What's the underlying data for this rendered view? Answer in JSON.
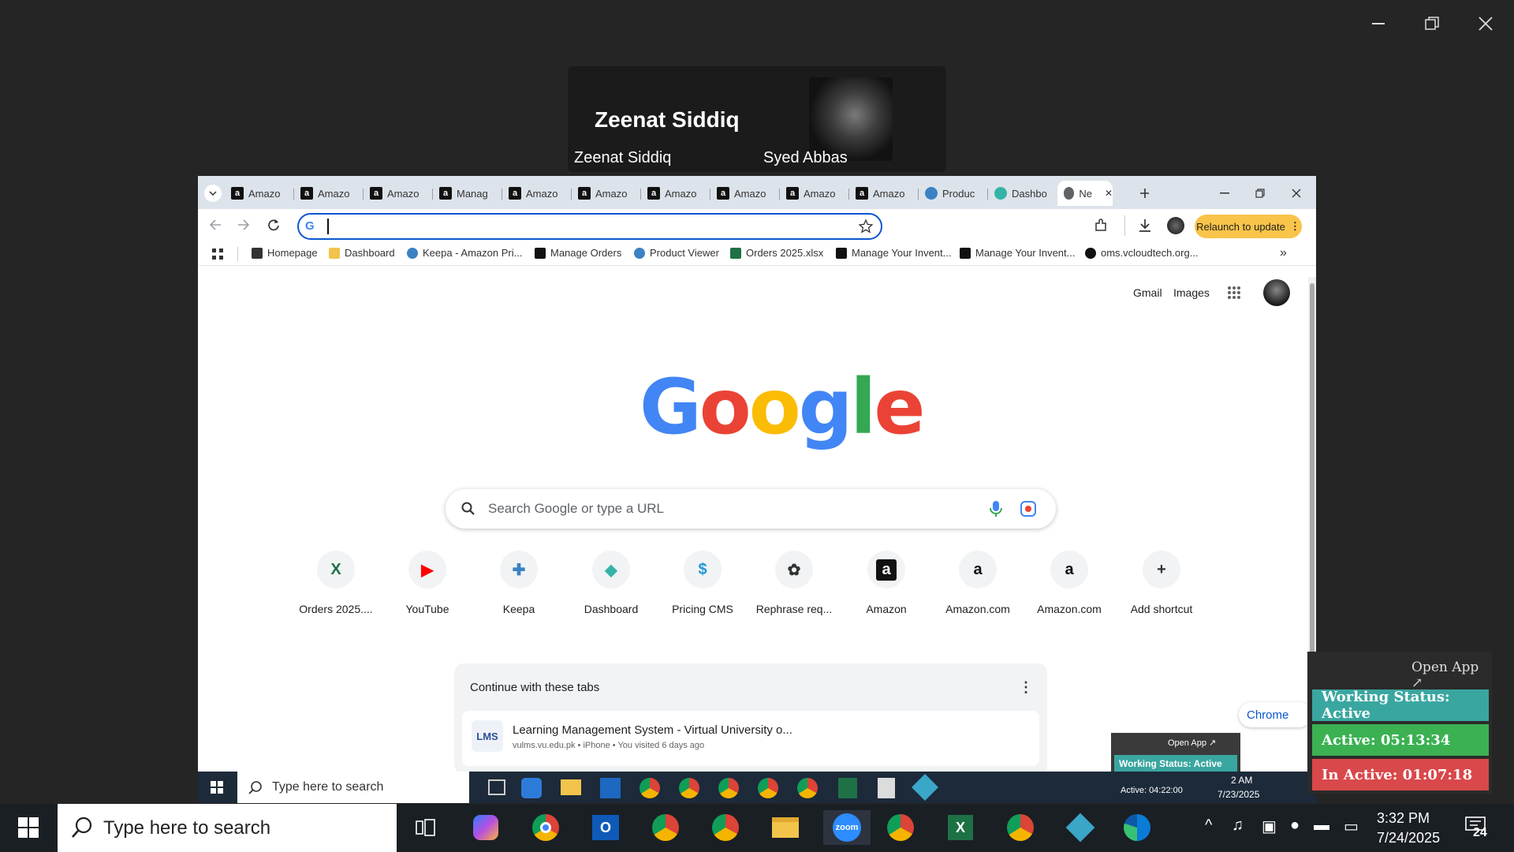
{
  "window": {
    "controls": [
      "minimize",
      "restore",
      "close"
    ]
  },
  "participants": {
    "speaker_name": "Zeenat Siddiq",
    "tiles": [
      {
        "label": "Zeenat Siddiq"
      },
      {
        "label": "Syed Abbas"
      }
    ]
  },
  "browser": {
    "tabs": [
      {
        "label": "Amazo",
        "icon": "amazon-icon"
      },
      {
        "label": "Amazo",
        "icon": "amazon-icon"
      },
      {
        "label": "Amazo",
        "icon": "amazon-icon"
      },
      {
        "label": "Manag",
        "icon": "amazon-icon"
      },
      {
        "label": "Amazo",
        "icon": "amazon-icon"
      },
      {
        "label": "Amazo",
        "icon": "amazon-icon"
      },
      {
        "label": "Amazo",
        "icon": "amazon-icon"
      },
      {
        "label": "Amazo",
        "icon": "amazon-icon"
      },
      {
        "label": "Amazo",
        "icon": "amazon-icon"
      },
      {
        "label": "Amazo",
        "icon": "amazon-icon"
      },
      {
        "label": "Produc",
        "icon": "keepa-icon"
      },
      {
        "label": "Dashbo",
        "icon": "dashboard-icon"
      },
      {
        "label": "Ne",
        "icon": "chrome-icon",
        "active": true
      }
    ],
    "relaunch_label": "Relaunch to update",
    "bookmarks": [
      {
        "label": "Homepage"
      },
      {
        "label": "Dashboard"
      },
      {
        "label": "Keepa - Amazon Pri..."
      },
      {
        "label": "Manage Orders"
      },
      {
        "label": "Product Viewer"
      },
      {
        "label": "Orders 2025.xlsx"
      },
      {
        "label": "Manage Your Invent..."
      },
      {
        "label": "Manage Your Invent..."
      },
      {
        "label": "oms.vcloudtech.org..."
      }
    ],
    "google": {
      "header_links": [
        "Gmail",
        "Images"
      ],
      "search_placeholder": "Search Google or type a URL",
      "shortcuts": [
        {
          "label": "Orders 2025...."
        },
        {
          "label": "YouTube"
        },
        {
          "label": "Keepa"
        },
        {
          "label": "Dashboard"
        },
        {
          "label": "Pricing CMS"
        },
        {
          "label": "Rephrase req..."
        },
        {
          "label": "Amazon"
        },
        {
          "label": "Amazon.com"
        },
        {
          "label": "Amazon.com"
        },
        {
          "label": "Add shortcut"
        }
      ],
      "continue_title": "Continue with these tabs",
      "continue_item_title": "Learning Management System - Virtual University o...",
      "continue_item_meta": "vulms.vu.edu.pk • iPhone • You visited 6 days ago",
      "continue_item_icon_text": "LMS",
      "chrome_link": "Chrome"
    },
    "inner_taskbar": {
      "search_placeholder": "Type here to search",
      "time": "2 AM",
      "date": "7/23/2025",
      "mini_status": {
        "open_app": "Open App ↗",
        "status": "Working Status: Active",
        "active": "Active: 04:22:00"
      }
    }
  },
  "status_widget": {
    "open_app": "Open App ↗",
    "working_status": "Working Status: Active",
    "active": "Active: 05:13:34",
    "inactive": "In Active: 01:07:18",
    "colors": {
      "working": "#3aa6a0",
      "active": "#3bb152",
      "inactive": "#d9484a"
    }
  },
  "taskbar": {
    "search_placeholder": "Type here to search",
    "time": "3:32 PM",
    "date": "7/24/2025",
    "notification_count": "24"
  }
}
